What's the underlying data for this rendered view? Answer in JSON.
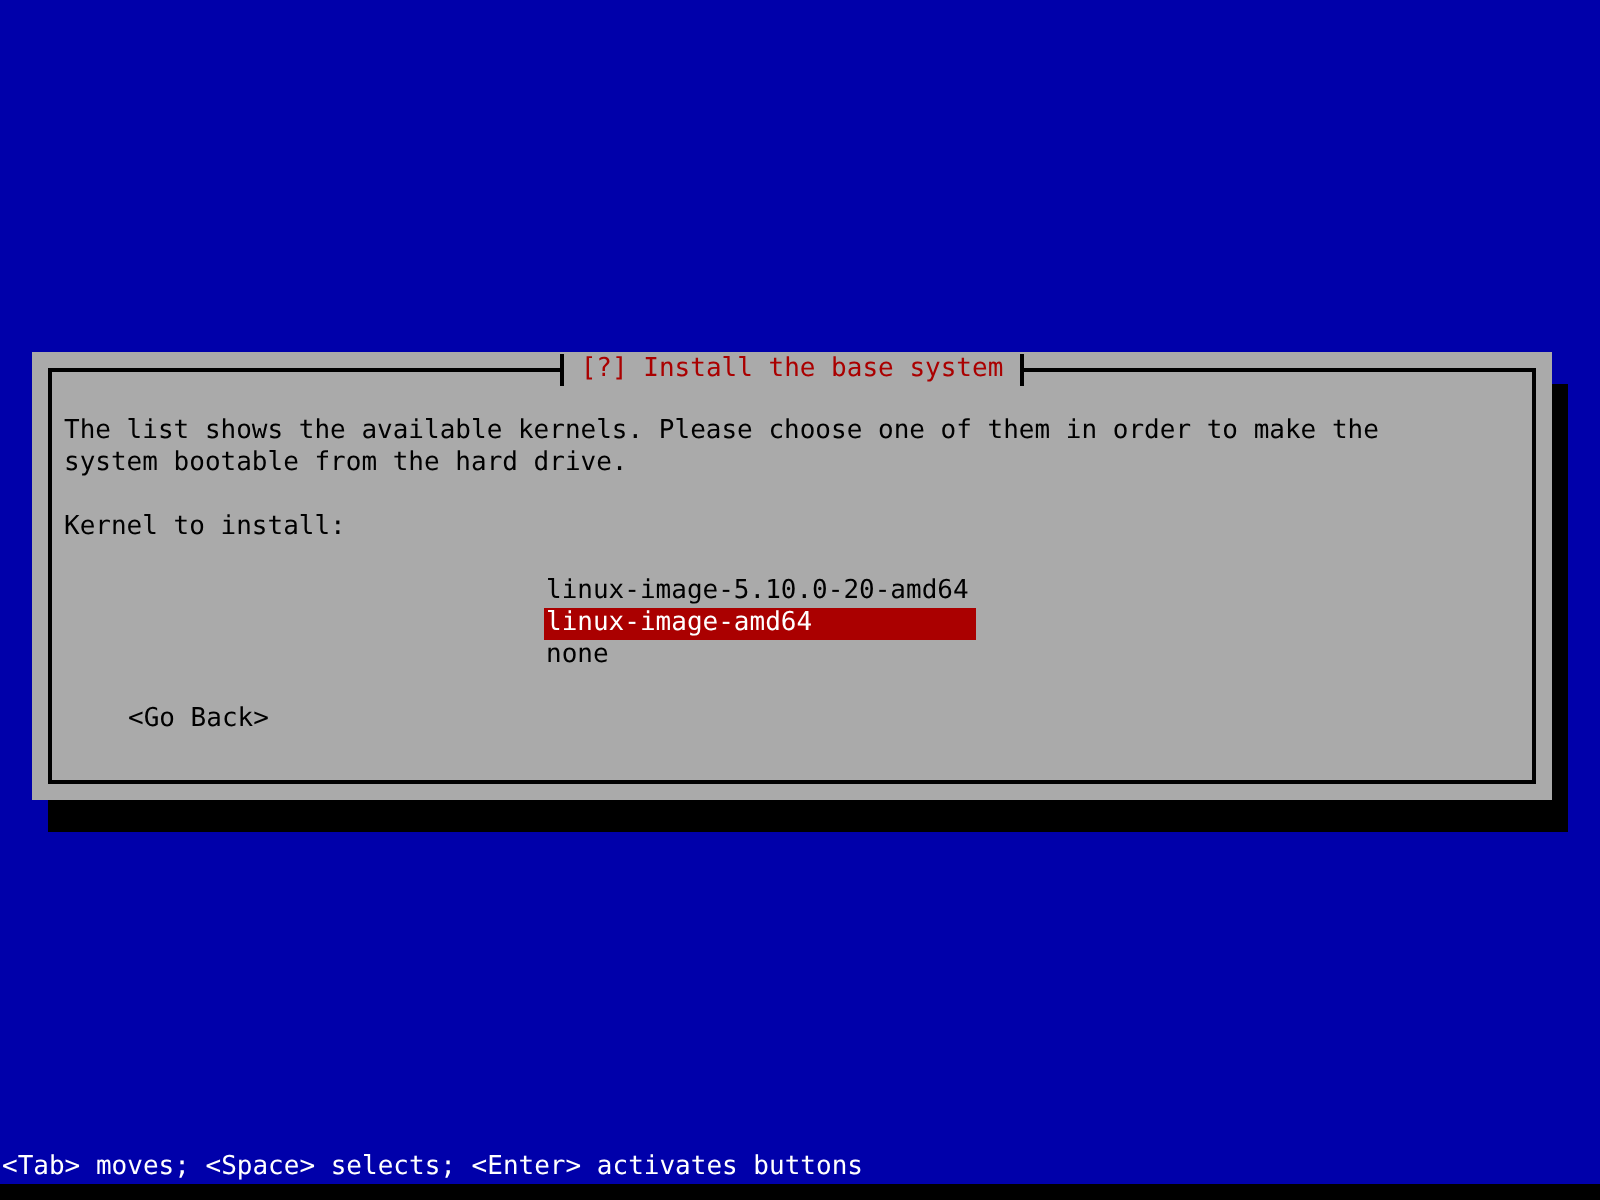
{
  "dialog": {
    "title": "[?] Install the base system",
    "message": "The list shows the available kernels. Please choose one of them in order to make the system bootable from the hard drive.",
    "prompt": "Kernel to install:",
    "options": [
      {
        "label": "linux-image-5.10.0-20-amd64",
        "selected": false
      },
      {
        "label": "linux-image-amd64",
        "selected": true
      },
      {
        "label": "none",
        "selected": false
      }
    ],
    "buttons": [
      "<Go Back>"
    ]
  },
  "status_bar": "<Tab> moves; <Space> selects; <Enter> activates buttons"
}
